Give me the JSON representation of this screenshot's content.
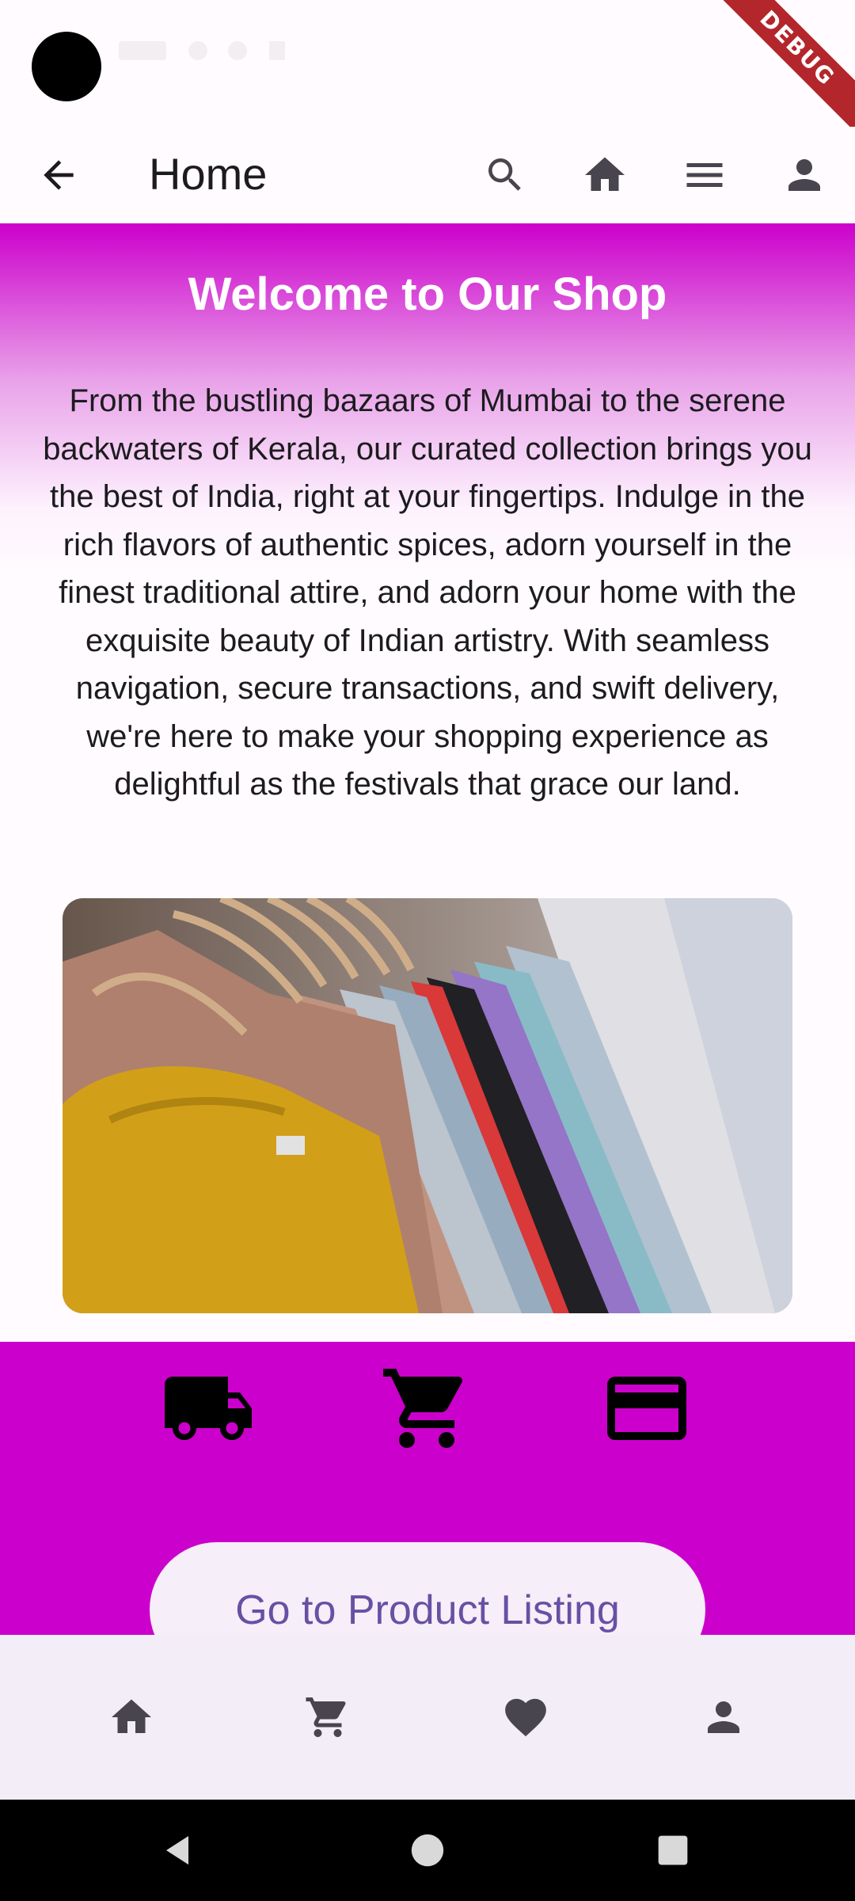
{
  "app_bar": {
    "title": "Home",
    "back_icon": "arrow-back-icon",
    "actions": [
      "search-icon",
      "home-icon",
      "menu-icon",
      "person-icon"
    ]
  },
  "debug_banner": "DEBUG",
  "hero": {
    "title": "Welcome to Our Shop",
    "description": "From the bustling bazaars of Mumbai to the serene backwaters of Kerala, our curated collection brings you the best of India, right at your fingertips. Indulge in the rich flavors of authentic spices, adorn yourself in the finest traditional attire, and adorn your home with the exquisite beauty of Indian artistry. With seamless navigation, secure transactions, and swift delivery, we're here to make your shopping experience as delightful as the festivals that grace our land."
  },
  "features": {
    "icons": [
      "delivery-truck-icon",
      "shopping-cart-icon",
      "credit-card-icon"
    ],
    "cta_label": "Go to Product Listing"
  },
  "bottom_nav": {
    "items": [
      "home-icon",
      "cart-icon",
      "favorite-icon",
      "person-icon"
    ]
  },
  "colors": {
    "accent": "#cc00cc",
    "primary_text": "#6750a4",
    "nav_background": "#f3edf7"
  }
}
